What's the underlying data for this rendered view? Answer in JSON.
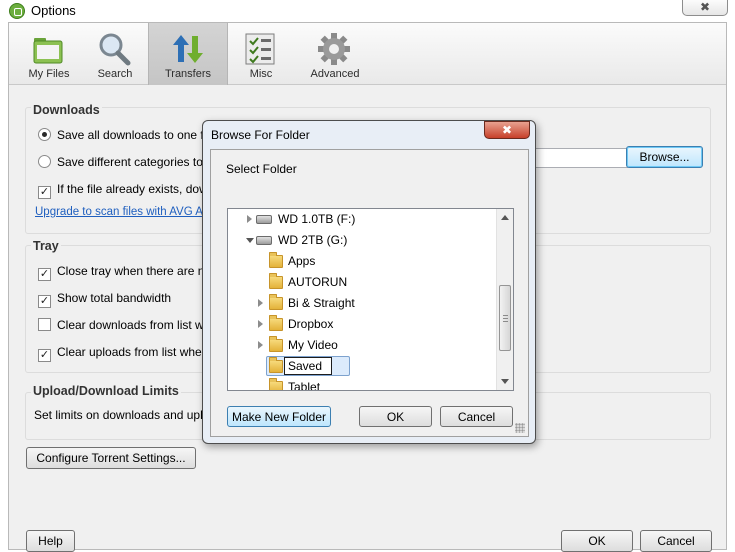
{
  "window": {
    "title": "Options",
    "close_glyph": "✖",
    "icon": "app-logo-icon"
  },
  "toolbar": {
    "tabs": [
      {
        "label": "My Files",
        "icon": "folder-icon"
      },
      {
        "label": "Search",
        "icon": "magnifier-icon"
      },
      {
        "label": "Transfers",
        "icon": "transfer-arrows-icon",
        "active": true
      },
      {
        "label": "Misc",
        "icon": "checklist-icon"
      },
      {
        "label": "Advanced",
        "icon": "gear-icon"
      }
    ]
  },
  "downloads": {
    "title": "Downloads",
    "option_one_folder": "Save all downloads to one folder",
    "option_categories": "Save different categories to di",
    "option_file_exists": "If the file already exists, down",
    "upgrade_link": "Upgrade to scan files with AVG Ant",
    "browse_label": "Browse..."
  },
  "tray": {
    "title": "Tray",
    "close_tray": "Close tray when there are no t",
    "show_bandwidth": "Show total bandwidth",
    "clear_downloads": "Clear downloads from list wher",
    "clear_uploads": "Clear uploads from list when fi"
  },
  "limits": {
    "title": "Upload/Download Limits",
    "description": "Set limits on downloads and uploads"
  },
  "buttons": {
    "torrent_settings": "Configure Torrent Settings...",
    "help": "Help",
    "ok": "OK",
    "cancel": "Cancel"
  },
  "dialog": {
    "title": "Browse For Folder",
    "close_glyph": "✖",
    "subtitle": "Select Folder",
    "tree": [
      {
        "label": "WD 1.0TB (F:)",
        "type": "drive",
        "expander": "collapsed"
      },
      {
        "label": "WD 2TB (G:)",
        "type": "drive",
        "expander": "expanded"
      },
      {
        "label": "Apps",
        "type": "folder",
        "expander": "none"
      },
      {
        "label": "AUTORUN",
        "type": "folder",
        "expander": "none"
      },
      {
        "label": "Bi & Straight",
        "type": "folder",
        "expander": "collapsed"
      },
      {
        "label": "Dropbox",
        "type": "folder",
        "expander": "collapsed"
      },
      {
        "label": "My Video",
        "type": "folder",
        "expander": "collapsed"
      },
      {
        "label": "Saved",
        "type": "folder",
        "expander": "none",
        "editing": true
      },
      {
        "label": "Tablet",
        "type": "folder",
        "expander": "none"
      }
    ],
    "make_new_folder": "Make New Folder",
    "ok": "OK",
    "cancel": "Cancel"
  },
  "colors": {
    "accent_link": "#1f5fbf",
    "dialog_frame": "#e8eef6",
    "close_red": "#c7402a",
    "selection": "#dcebfc"
  }
}
